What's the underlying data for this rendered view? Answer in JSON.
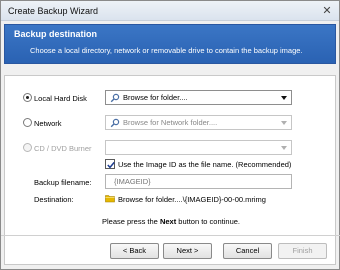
{
  "window": {
    "title": "Create Backup Wizard",
    "close_glyph": "✕"
  },
  "banner": {
    "title": "Backup destination",
    "description": "Choose a local directory, network  or removable drive to contain the backup image."
  },
  "options": {
    "local": {
      "label": "Local Hard Disk",
      "selected": true,
      "value": "Browse for folder...."
    },
    "network": {
      "label": "Network",
      "selected": false,
      "value": "Browse for Network folder...."
    },
    "cd": {
      "label": "CD / DVD Burner",
      "selected": false,
      "value": ""
    }
  },
  "use_image_id": {
    "label": "Use the Image ID as the file name.  (Recommended)",
    "checked": true
  },
  "backup_filename": {
    "label": "Backup filename:",
    "value": "",
    "placeholder": "{IMAGEID}"
  },
  "destination": {
    "label": "Destination:",
    "value": "Browse for folder....\\{IMAGEID}-00-00.mrimg"
  },
  "hint": {
    "prefix": "Please press the ",
    "strong": "Next",
    "suffix": " button to continue."
  },
  "buttons": {
    "back": "< Back",
    "next": "Next >",
    "cancel": "Cancel",
    "finish": "Finish"
  },
  "icons": {
    "folder": "folder-icon",
    "close": "close-icon"
  },
  "colors": {
    "banner": "#2a62b3",
    "folder": "#e6b800"
  }
}
